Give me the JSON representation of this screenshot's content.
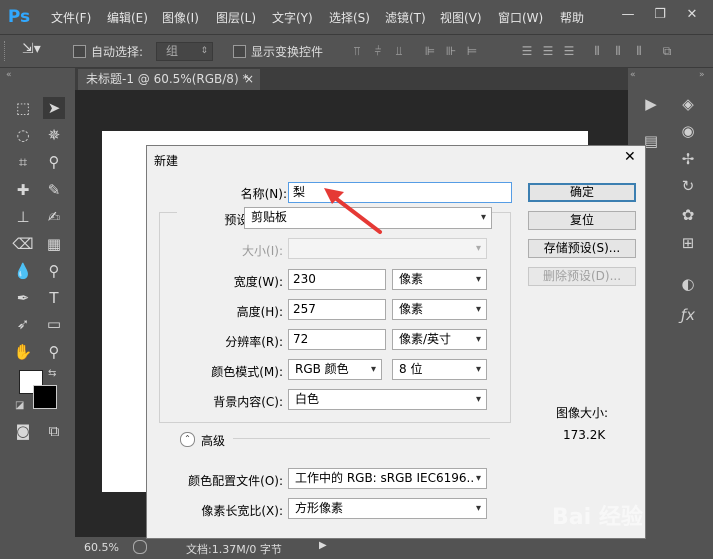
{
  "app": {
    "logo": "Ps"
  },
  "menu": [
    "文件(F)",
    "编辑(E)",
    "图像(I)",
    "图层(L)",
    "文字(Y)",
    "选择(S)",
    "滤镜(T)",
    "视图(V)",
    "窗口(W)",
    "帮助"
  ],
  "options": {
    "auto_select_label": "自动选择:",
    "auto_select_value": "组",
    "show_transform_label": "显示变换控件"
  },
  "document": {
    "tab_title": "未标题-1 @ 60.5%(RGB/8) *",
    "tab_close": "×",
    "zoom": "60.5%",
    "doc_info": "文档:1.37M/0 字节"
  },
  "dialog": {
    "title": "新建",
    "close": "✕",
    "name_label": "名称(N):",
    "name_value": "梨",
    "preset_label": "预设(P):",
    "preset_value": "剪贴板",
    "size_label": "大小(I):",
    "width_label": "宽度(W):",
    "width_value": "230",
    "width_unit": "像素",
    "height_label": "高度(H):",
    "height_value": "257",
    "height_unit": "像素",
    "resolution_label": "分辨率(R):",
    "resolution_value": "72",
    "resolution_unit": "像素/英寸",
    "color_mode_label": "颜色模式(M):",
    "color_mode_value": "RGB 颜色",
    "bit_depth_value": "8 位",
    "background_label": "背景内容(C):",
    "background_value": "白色",
    "advanced_label": "高级",
    "color_profile_label": "颜色配置文件(O):",
    "color_profile_value": "工作中的 RGB: sRGB IEC6196...",
    "pixel_aspect_label": "像素长宽比(X):",
    "pixel_aspect_value": "方形像素",
    "ok_button": "确定",
    "reset_button": "复位",
    "save_preset_button": "存储预设(S)...",
    "delete_preset_button": "删除预设(D)...",
    "image_size_label": "图像大小:",
    "image_size_value": "173.2K"
  },
  "watermark": "Bai 经验",
  "colors": {
    "accent_arrow": "#e53935",
    "ps_blue": "#31a8ff",
    "ui_gray": "#535353"
  }
}
